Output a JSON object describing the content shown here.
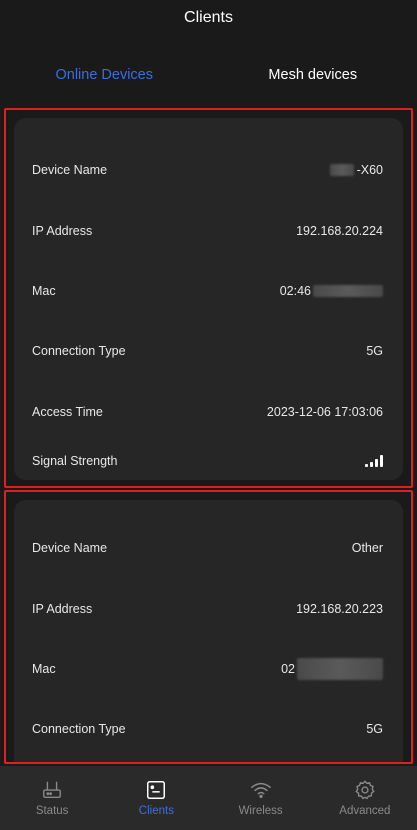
{
  "header": {
    "title": "Clients"
  },
  "tabs": [
    {
      "label": "Online Devices",
      "active": true
    },
    {
      "label": "Mesh devices",
      "active": false
    }
  ],
  "devices": [
    {
      "rows": [
        {
          "label": "Device Name",
          "value": "-X60"
        },
        {
          "label": "IP Address",
          "value": "192.168.20.224"
        },
        {
          "label": "Mac",
          "value": "02:46"
        },
        {
          "label": "Connection Type",
          "value": "5G"
        },
        {
          "label": "Access Time",
          "value": "2023-12-06 17:03:06"
        },
        {
          "label": "Signal Strength",
          "value_icon": "signal-strength-icon",
          "signal_level": 4
        }
      ]
    },
    {
      "rows": [
        {
          "label": "Device Name",
          "value": "Other"
        },
        {
          "label": "IP Address",
          "value": "192.168.20.223"
        },
        {
          "label": "Mac",
          "value": "02"
        },
        {
          "label": "Connection Type",
          "value": "5G"
        }
      ]
    }
  ],
  "navbar": {
    "items": [
      {
        "label": "Status",
        "icon": "router-icon",
        "active": false
      },
      {
        "label": "Clients",
        "icon": "clients-icon",
        "active": true
      },
      {
        "label": "Wireless",
        "icon": "wifi-icon",
        "active": false
      },
      {
        "label": "Advanced",
        "icon": "gear-icon",
        "active": false
      }
    ]
  },
  "colors": {
    "accent": "#3c6ee0",
    "highlight_border": "#e02020",
    "card_bg": "#262626",
    "page_bg": "#1a1a1a"
  }
}
